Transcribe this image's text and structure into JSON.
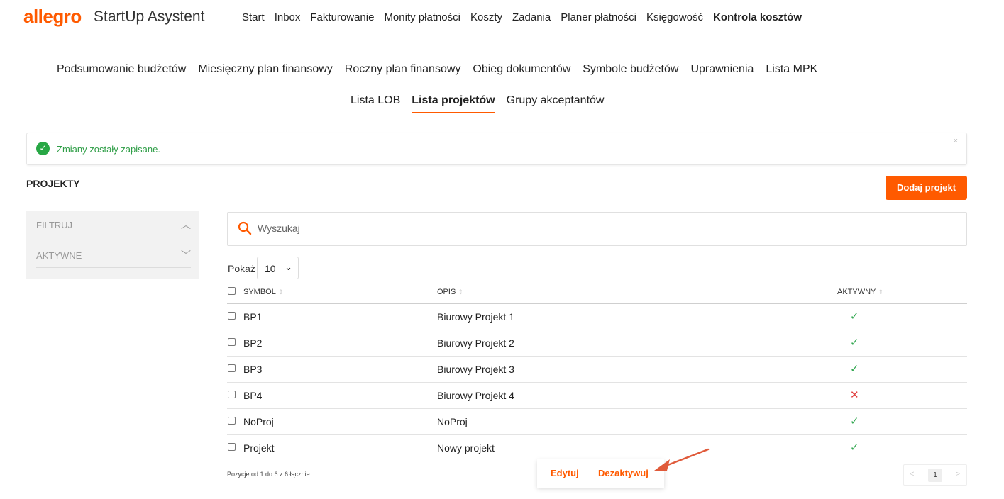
{
  "brand": {
    "logo": "allegro",
    "app_name": "StartUp Asystent"
  },
  "top_menu": [
    {
      "label": "Start"
    },
    {
      "label": "Inbox"
    },
    {
      "label": "Fakturowanie"
    },
    {
      "label": "Monity płatności"
    },
    {
      "label": "Koszty"
    },
    {
      "label": "Zadania"
    },
    {
      "label": "Planer płatności"
    },
    {
      "label": "Księgowość"
    },
    {
      "label": "Kontrola kosztów"
    }
  ],
  "sub_menu": [
    {
      "label": "Podsumowanie budżetów"
    },
    {
      "label": "Miesięczny plan finansowy"
    },
    {
      "label": "Roczny plan finansowy"
    },
    {
      "label": "Obieg dokumentów"
    },
    {
      "label": "Symbole budżetów"
    },
    {
      "label": "Uprawnienia"
    },
    {
      "label": "Lista MPK"
    }
  ],
  "tabs": [
    {
      "label": "Lista LOB"
    },
    {
      "label": "Lista projektów"
    },
    {
      "label": "Grupy akceptantów"
    }
  ],
  "alert": {
    "text": "Zmiany zostały zapisane.",
    "close": "×"
  },
  "section_title": "PROJEKTY",
  "add_button": "Dodaj projekt",
  "filters": [
    {
      "label": "FILTRUJ",
      "chevron": "︿"
    },
    {
      "label": "AKTYWNE",
      "chevron": "﹀"
    }
  ],
  "search": {
    "placeholder": "Wyszukaj"
  },
  "page_size": {
    "label": "Pokaż",
    "value": "10"
  },
  "table": {
    "headers": {
      "symbol": "SYMBOL",
      "opis": "OPIS",
      "active": "AKTYWNY"
    },
    "rows": [
      {
        "symbol": "BP1",
        "opis": "Biurowy Projekt 1",
        "active_mark": "✓"
      },
      {
        "symbol": "BP2",
        "opis": "Biurowy Projekt 2",
        "active_mark": "✓"
      },
      {
        "symbol": "BP3",
        "opis": "Biurowy Projekt 3",
        "active_mark": "✓"
      },
      {
        "symbol": "BP4",
        "opis": "Biurowy Projekt 4",
        "active_mark": "✕"
      },
      {
        "symbol": "NoProj",
        "opis": "NoProj",
        "active_mark": "✓"
      },
      {
        "symbol": "Projekt",
        "opis": "Nowy projekt",
        "active_mark": "✓"
      }
    ]
  },
  "footer_info": "Pozycje od 1 do 6 z 6 łącznie",
  "context_menu": {
    "edit": "Edytuj",
    "deactivate": "Dezaktywuj"
  },
  "pagination": {
    "prev": "<",
    "current": "1",
    "next": ">"
  },
  "colors": {
    "accent": "#ff5a00",
    "success": "#35a853",
    "error": "#e03b3b",
    "annotation_arrow": "#e05a3a"
  }
}
